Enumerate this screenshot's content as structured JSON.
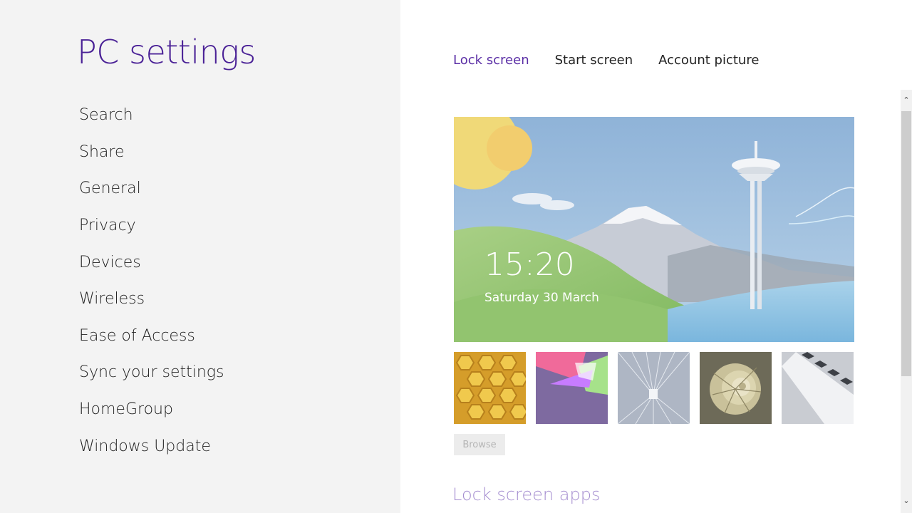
{
  "app": {
    "title": "PC settings"
  },
  "nav": {
    "items": [
      {
        "label": "Search"
      },
      {
        "label": "Share"
      },
      {
        "label": "General"
      },
      {
        "label": "Privacy"
      },
      {
        "label": "Devices"
      },
      {
        "label": "Wireless"
      },
      {
        "label": "Ease of Access"
      },
      {
        "label": "Sync your settings"
      },
      {
        "label": "HomeGroup"
      },
      {
        "label": "Windows Update"
      }
    ]
  },
  "tabs": [
    {
      "label": "Lock screen",
      "active": true
    },
    {
      "label": "Start screen",
      "active": false
    },
    {
      "label": "Account picture",
      "active": false
    }
  ],
  "preview": {
    "time": "15:20",
    "date": "Saturday 30 March"
  },
  "thumbnails": [
    {
      "name": "honeycomb"
    },
    {
      "name": "geometric"
    },
    {
      "name": "tunnel"
    },
    {
      "name": "nautilus"
    },
    {
      "name": "piano"
    }
  ],
  "browse": {
    "label": "Browse"
  },
  "section": {
    "heading": "Lock screen apps"
  },
  "colors": {
    "accent": "#4a2196",
    "active_tab": "#5b2fa6",
    "left_bg": "#f3f3f3"
  },
  "icons": {
    "scroll_up": "chevron-up-icon",
    "scroll_down": "chevron-down-icon"
  }
}
